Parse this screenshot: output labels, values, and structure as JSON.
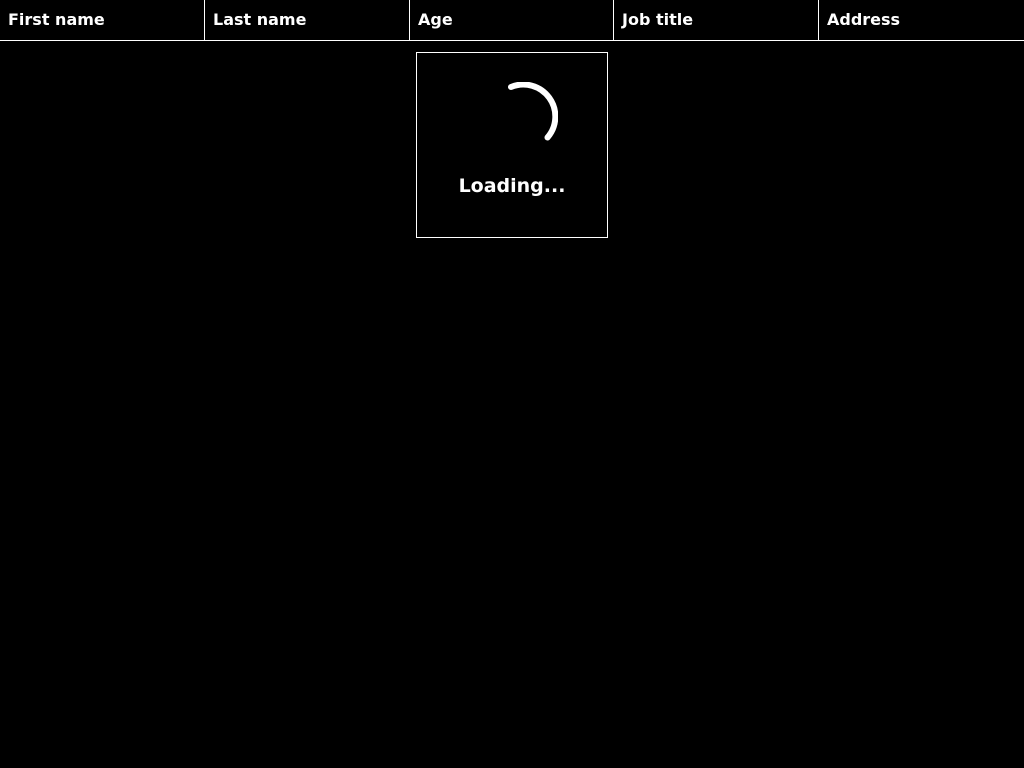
{
  "grid": {
    "columns": [
      {
        "label": "First name"
      },
      {
        "label": "Last name"
      },
      {
        "label": "Age"
      },
      {
        "label": "Job title"
      },
      {
        "label": "Address"
      }
    ],
    "loading": {
      "icon": "spinner-icon",
      "text": "Loading..."
    }
  },
  "colors": {
    "background": "#000000",
    "foreground": "#ffffff"
  }
}
